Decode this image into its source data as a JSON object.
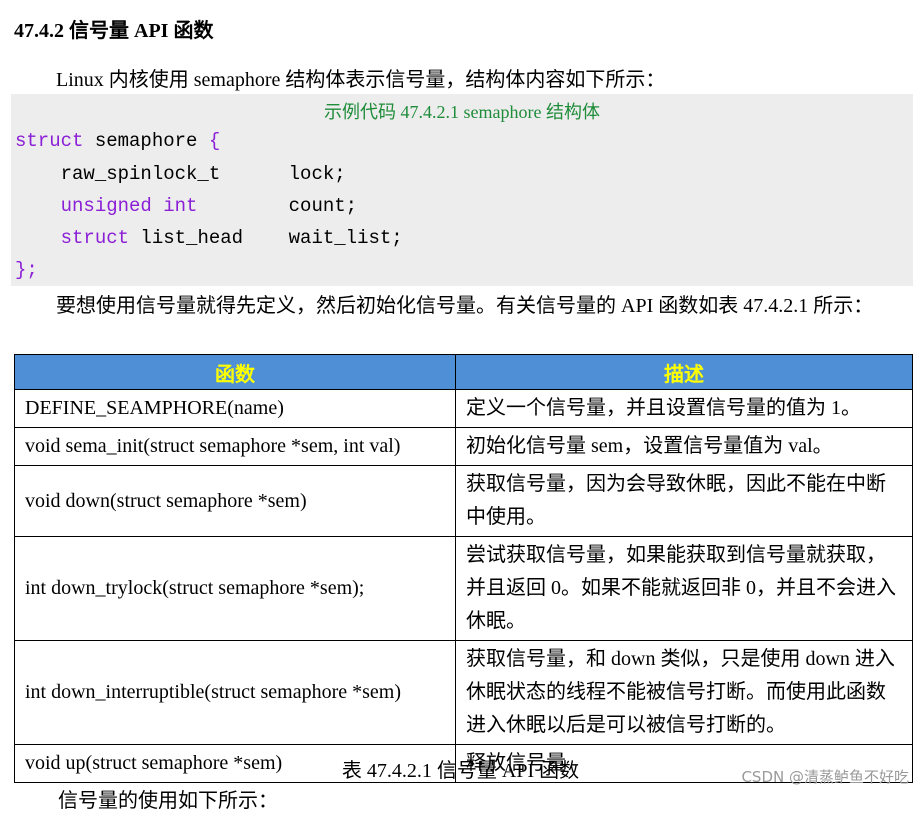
{
  "section": {
    "heading": "47.4.2  信号量 API 函数"
  },
  "intro": "Linux 内核使用 semaphore 结构体表示信号量，结构体内容如下所示：",
  "code": {
    "caption": "示例代码 47.4.2.1 semaphore 结构体",
    "line1_kw": "struct",
    "line1_rest": " semaphore ",
    "line1_brace": "{",
    "line2": "    raw_spinlock_t      lock;",
    "line3_kw": "unsigned int",
    "line3_rest": "        count;",
    "line4_kw": "struct",
    "line4_rest": " list_head    wait_list;",
    "line5": "};"
  },
  "para2": "要想使用信号量就得先定义，然后初始化信号量。有关信号量的 API 函数如表 47.4.2.1 所示：",
  "table": {
    "headers": [
      "函数",
      "描述"
    ],
    "rows": [
      {
        "fn": "DEFINE_SEAMPHORE(name)",
        "desc": "定义一个信号量，并且设置信号量的值为 1。"
      },
      {
        "fn": "void sema_init(struct semaphore *sem, int val)",
        "desc": "初始化信号量 sem，设置信号量值为 val。"
      },
      {
        "fn": "void down(struct semaphore *sem)",
        "desc": "获取信号量，因为会导致休眠，因此不能在中断中使用。"
      },
      {
        "fn": "int down_trylock(struct semaphore *sem);",
        "desc": "尝试获取信号量，如果能获取到信号量就获取，并且返回 0。如果不能就返回非 0，并且不会进入休眠。"
      },
      {
        "fn": "int down_interruptible(struct semaphore *sem)",
        "desc": "获取信号量，和 down 类似，只是使用 down 进入休眠状态的线程不能被信号打断。而使用此函数进入休眠以后是可以被信号打断的。"
      },
      {
        "fn": "void up(struct semaphore *sem)",
        "desc": "释放信号量"
      }
    ]
  },
  "table_caption": "表 47.4.2.1  信号量 API 函数",
  "partial_line": "信号量的使用如下所示：",
  "watermark": "CSDN @清蒸鲈鱼不好吃"
}
